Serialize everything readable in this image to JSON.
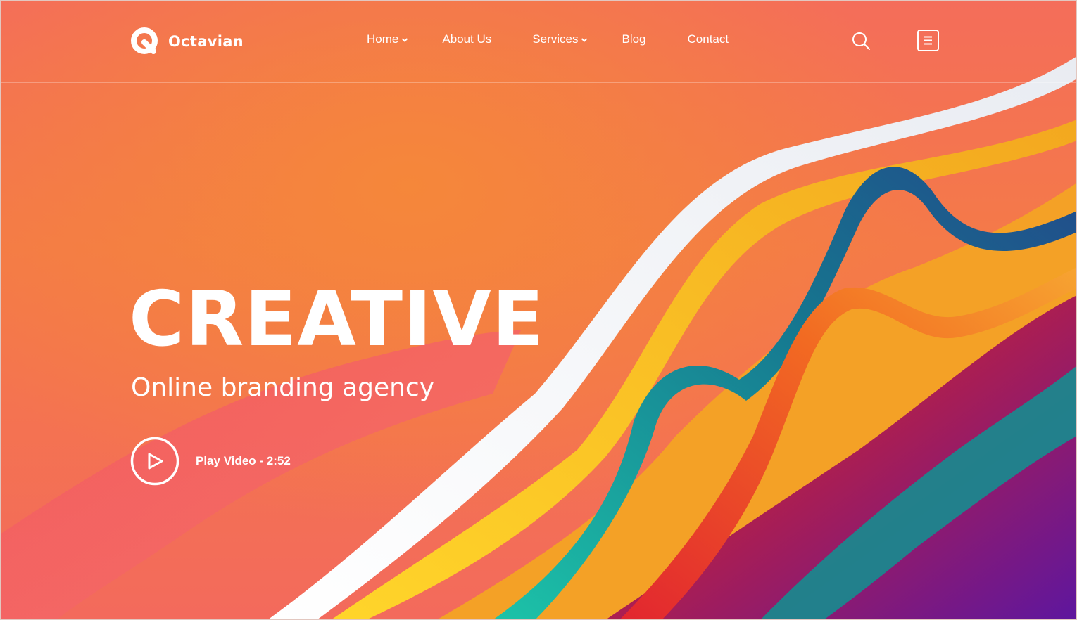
{
  "brand": {
    "name": "Octavian",
    "logo_icon": "octavian-q-logo-icon"
  },
  "nav": {
    "items": [
      {
        "label": "Home",
        "has_dropdown": true
      },
      {
        "label": "About Us",
        "has_dropdown": false
      },
      {
        "label": "Services",
        "has_dropdown": true
      },
      {
        "label": "Blog",
        "has_dropdown": false
      },
      {
        "label": "Contact",
        "has_dropdown": false
      }
    ],
    "search_icon": "search-icon",
    "menu_icon": "menu-icon"
  },
  "hero": {
    "title": "CREATIVE",
    "subtitle": "Online branding agency",
    "play_label": "Play Video - 2:52",
    "play_icon": "play-icon"
  },
  "colors": {
    "background": "#f47a48",
    "text": "#ffffff",
    "ribbon_yellow": "#f6c21c",
    "ribbon_teal": "#1f9fa0",
    "ribbon_red": "#e0332f",
    "ribbon_white": "#f4f4f4",
    "corner_purple": "#6a1aa0"
  }
}
